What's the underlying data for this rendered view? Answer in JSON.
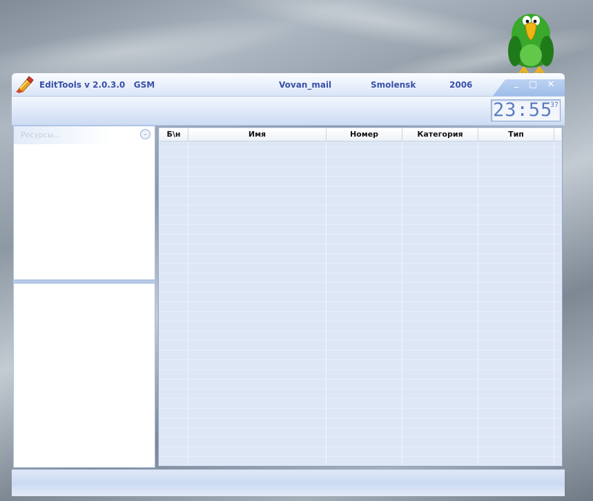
{
  "titlebar": {
    "app_title": "EditTools v 2.0.3.0   GSM",
    "author": "Vovan_mail",
    "city": "Smolensk",
    "year": "2006",
    "minimize_glyph": "_",
    "maximize_glyph": "□",
    "close_glyph": "✕"
  },
  "clock": {
    "time": "23:55",
    "seconds": "37"
  },
  "resources": {
    "title": "Ресурсы...",
    "toggle_glyph": "⌄"
  },
  "table": {
    "columns": [
      "Б\\н",
      "Имя",
      "Номер",
      "Категория",
      "Тип"
    ]
  },
  "colors": {
    "accent": "#3a4fa8",
    "grid_row": "#dde7f6",
    "panel_border": "#a9bfe1"
  },
  "icons": [
    "app-brush-icon",
    "parrot-mascot-icon",
    "minimize-icon",
    "maximize-icon",
    "close-icon",
    "collapse-chevron-icon"
  ]
}
